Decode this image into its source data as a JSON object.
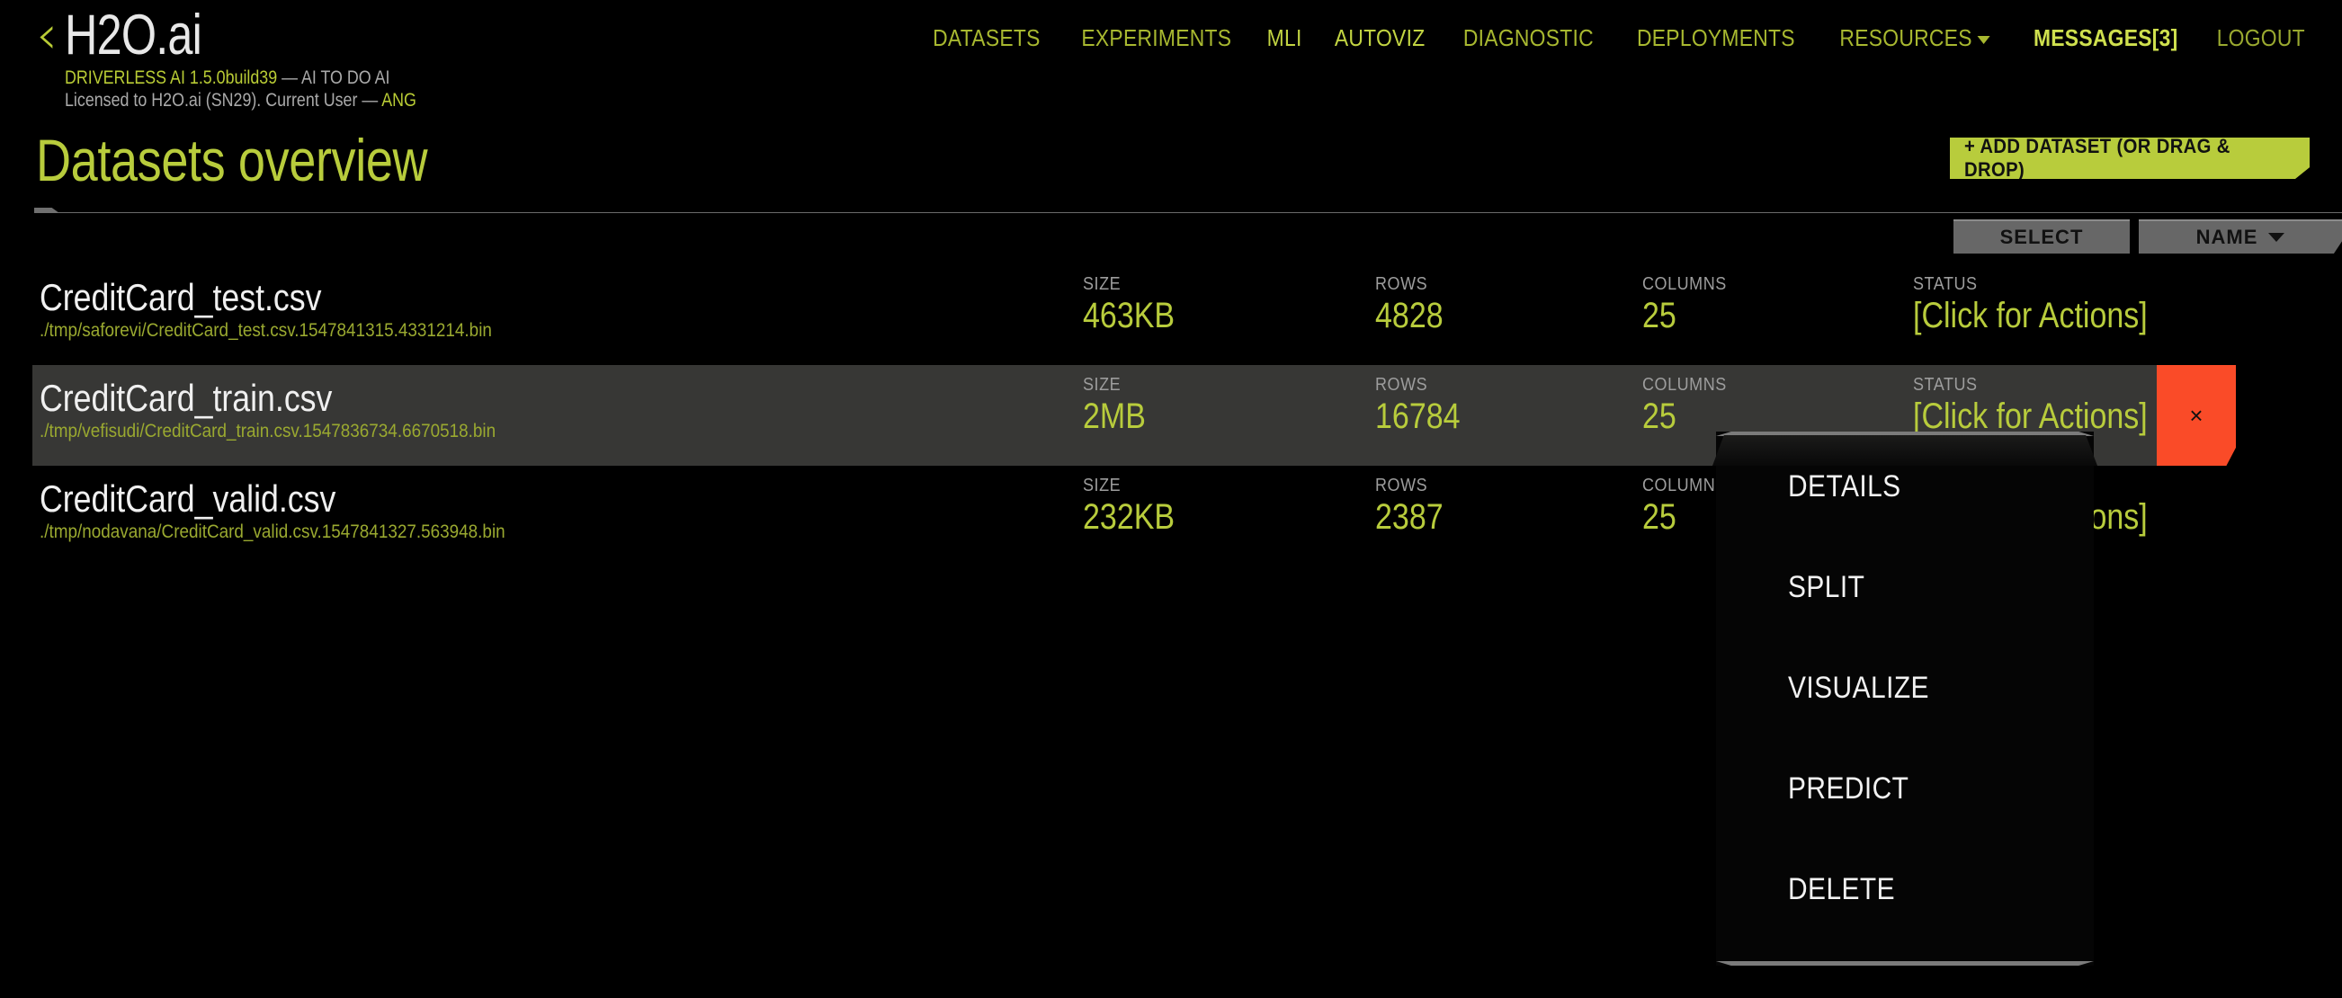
{
  "header": {
    "back_icon": "back-chevron-icon",
    "brand": "H2O.ai",
    "sub_line1_a": "DRIVERLESS AI 1.5.0build39",
    "sub_line1_b": " — AI TO DO AI",
    "sub_line2_a": "Licensed to H2O.ai (SN29). Current User — ",
    "sub_line2_b": "ANG",
    "nav": [
      {
        "label": "DATASETS",
        "style": "normal"
      },
      {
        "label": "EXPERIMENTS",
        "style": "normal"
      },
      {
        "label": "MLI",
        "style": "bright"
      },
      {
        "label": "AUTOVIZ",
        "style": "bright"
      },
      {
        "label": "DIAGNOSTIC",
        "style": "normal"
      },
      {
        "label": "DEPLOYMENTS",
        "style": "normal"
      },
      {
        "label": "RESOURCES",
        "style": "normal",
        "caret": true
      },
      {
        "label": "MESSAGES[3]",
        "style": "bold"
      },
      {
        "label": "LOGOUT",
        "style": "dim"
      }
    ]
  },
  "title": {
    "page_title": "Datasets overview",
    "add_dataset_label": "+ ADD DATASET (OR DRAG & DROP)"
  },
  "toolbar": {
    "select_label": "SELECT",
    "sort_label": "NAME"
  },
  "columns": {
    "size": "SIZE",
    "rows": "ROWS",
    "columns": "COLUMNS",
    "status": "STATUS"
  },
  "datasets": [
    {
      "name": "CreditCard_test.csv",
      "path": "./tmp/saforevi/CreditCard_test.csv.1547841315.4331214.bin",
      "size": "463KB",
      "rows": "4828",
      "columns": "25",
      "status": "[Click for Actions]",
      "selected": false
    },
    {
      "name": "CreditCard_train.csv",
      "path": "./tmp/vefisudi/CreditCard_train.csv.1547836734.6670518.bin",
      "size": "2MB",
      "rows": "16784",
      "columns": "25",
      "status": "[Click for Actions]",
      "selected": true,
      "delete_label": "×"
    },
    {
      "name": "CreditCard_valid.csv",
      "path": "./tmp/nodavana/CreditCard_valid.csv.1547841327.563948.bin",
      "size": "232KB",
      "rows": "2387",
      "columns": "25",
      "status": "[Click for Actions]",
      "selected": false
    }
  ],
  "actions_menu": {
    "items": [
      "DETAILS",
      "SPLIT",
      "VISUALIZE",
      "PREDICT",
      "DELETE"
    ]
  },
  "colors": {
    "accent": "#b8cc3c",
    "nav": "#a8b830",
    "danger": "#fa4b28",
    "selected_row": "#373735",
    "background": "#000000"
  }
}
